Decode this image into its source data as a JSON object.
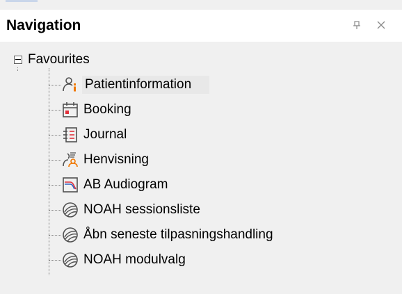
{
  "panel": {
    "title": "Navigation",
    "pin_glyph": "⊥",
    "close_glyph": "✕"
  },
  "tree": {
    "root": {
      "label": "Favourites",
      "expanded": true
    },
    "items": [
      {
        "label": "Patientinformation",
        "icon": "patient-info-icon",
        "selected": true
      },
      {
        "label": "Booking",
        "icon": "calendar-icon",
        "selected": false
      },
      {
        "label": "Journal",
        "icon": "journal-icon",
        "selected": false
      },
      {
        "label": "Henvisning",
        "icon": "referral-icon",
        "selected": false
      },
      {
        "label": "AB Audiogram",
        "icon": "audiogram-icon",
        "selected": false
      },
      {
        "label": "NOAH sessionsliste",
        "icon": "noah-icon",
        "selected": false
      },
      {
        "label": "Åbn seneste tilpasningshandling",
        "icon": "noah-icon",
        "selected": false
      },
      {
        "label": "NOAH modulvalg",
        "icon": "noah-icon",
        "selected": false
      }
    ]
  },
  "colors": {
    "accent_orange": "#f07800",
    "accent_red": "#e0303a",
    "accent_blue": "#3060c0",
    "icon_gray": "#505050"
  }
}
